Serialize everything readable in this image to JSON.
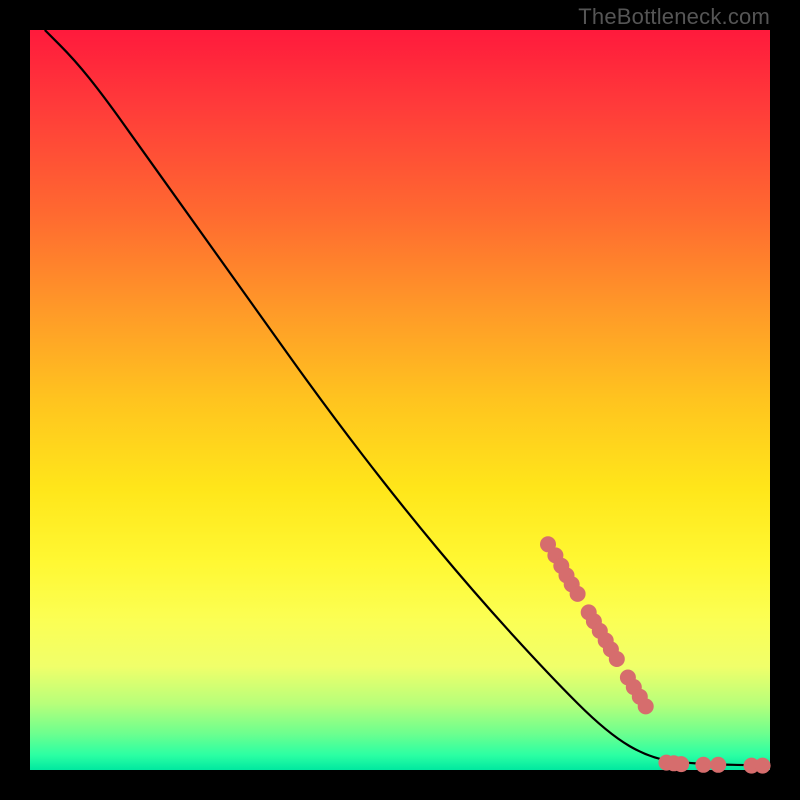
{
  "watermark": "TheBottleneck.com",
  "chart_data": {
    "type": "line",
    "title": "",
    "xlabel": "",
    "ylabel": "",
    "xlim": [
      0,
      100
    ],
    "ylim": [
      0,
      100
    ],
    "grid": false,
    "legend": false,
    "curve": [
      {
        "x": 2,
        "y": 100
      },
      {
        "x": 6,
        "y": 96
      },
      {
        "x": 10,
        "y": 91
      },
      {
        "x": 15,
        "y": 84
      },
      {
        "x": 20,
        "y": 77
      },
      {
        "x": 30,
        "y": 63
      },
      {
        "x": 40,
        "y": 49
      },
      {
        "x": 50,
        "y": 36
      },
      {
        "x": 60,
        "y": 24
      },
      {
        "x": 70,
        "y": 13
      },
      {
        "x": 78,
        "y": 5
      },
      {
        "x": 84,
        "y": 1.5
      },
      {
        "x": 90,
        "y": 0.8
      },
      {
        "x": 100,
        "y": 0.6
      }
    ],
    "markers": [
      {
        "x": 70.0,
        "y": 30.5
      },
      {
        "x": 71.0,
        "y": 29.0
      },
      {
        "x": 71.8,
        "y": 27.6
      },
      {
        "x": 72.5,
        "y": 26.3
      },
      {
        "x": 73.2,
        "y": 25.1
      },
      {
        "x": 74.0,
        "y": 23.8
      },
      {
        "x": 75.5,
        "y": 21.3
      },
      {
        "x": 76.2,
        "y": 20.1
      },
      {
        "x": 77.0,
        "y": 18.8
      },
      {
        "x": 77.8,
        "y": 17.5
      },
      {
        "x": 78.5,
        "y": 16.3
      },
      {
        "x": 79.3,
        "y": 15.0
      },
      {
        "x": 80.8,
        "y": 12.5
      },
      {
        "x": 81.6,
        "y": 11.2
      },
      {
        "x": 82.4,
        "y": 9.9
      },
      {
        "x": 83.2,
        "y": 8.6
      },
      {
        "x": 86.0,
        "y": 1.0
      },
      {
        "x": 87.0,
        "y": 0.9
      },
      {
        "x": 88.0,
        "y": 0.8
      },
      {
        "x": 91.0,
        "y": 0.7
      },
      {
        "x": 93.0,
        "y": 0.7
      },
      {
        "x": 97.5,
        "y": 0.6
      },
      {
        "x": 99.0,
        "y": 0.6
      }
    ]
  }
}
